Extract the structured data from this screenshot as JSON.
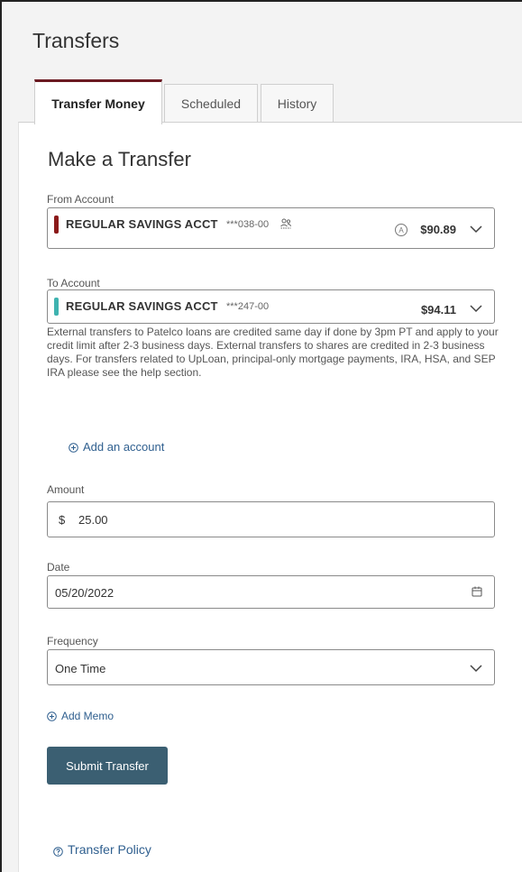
{
  "page": {
    "title": "Transfers"
  },
  "tabs": [
    {
      "label": "Transfer Money",
      "active": true
    },
    {
      "label": "Scheduled",
      "active": false
    },
    {
      "label": "History",
      "active": false
    }
  ],
  "form": {
    "heading": "Make a Transfer",
    "from_account": {
      "label": "From Account",
      "name": "REGULAR SAVINGS ACCT",
      "number": "***038-00",
      "badge": "A",
      "balance": "$90.89",
      "bar_color": "#8b1a1a"
    },
    "to_account": {
      "label": "To Account",
      "name": "REGULAR SAVINGS ACCT",
      "number": "***247-00",
      "balance": "$94.11",
      "bar_color": "#3fb3b0"
    },
    "notice": "External transfers to Patelco loans are credited same day if done by 3pm PT and apply to your credit limit after 2-3 business days. External transfers to shares are credited in 2-3 business days. For transfers related to UpLoan, principal-only mortgage payments, IRA, HSA, and SEP IRA please see the help section.",
    "add_account_label": "Add an account",
    "amount": {
      "label": "Amount",
      "currency": "$",
      "value": "25.00"
    },
    "date": {
      "label": "Date",
      "value": "05/20/2022"
    },
    "frequency": {
      "label": "Frequency",
      "value": "One Time"
    },
    "add_memo_label": "Add Memo",
    "submit_label": "Submit Transfer",
    "policy_label": "Transfer Policy"
  }
}
